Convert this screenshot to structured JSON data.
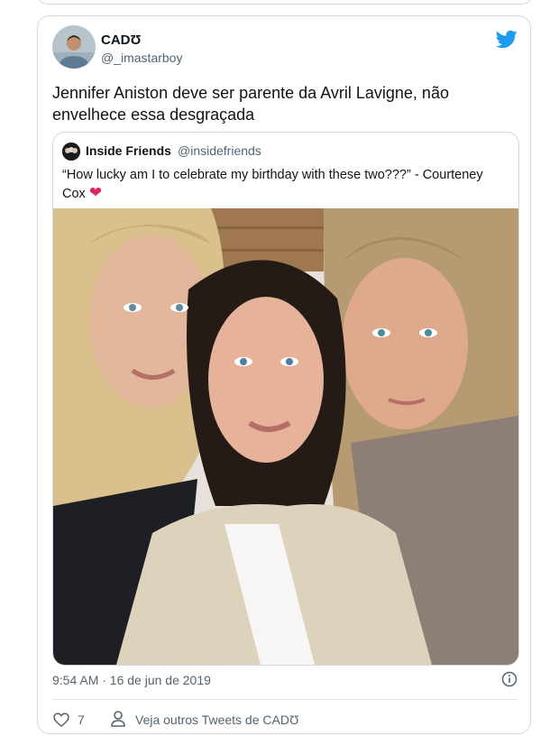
{
  "tweet": {
    "author_name": "CADƱ",
    "author_handle": "@_imastarboy",
    "text": "Jennifer Aniston deve ser parente da Avril Lavigne, não envelhece essa desgraçada",
    "timestamp": "9:54 AM · 16 de jun de 2019",
    "likes": "7",
    "more_tweets_label": "Veja outros Tweets de CADƱ"
  },
  "quoted": {
    "author_name": "Inside Friends",
    "author_handle": "@insidefriends",
    "text": "“How lucky am I to celebrate my birthday with these two???” - Courteney Cox",
    "emoji": "❤"
  },
  "colors": {
    "twitter_blue": "#1d9bf0",
    "secondary_text": "#536471",
    "border": "#cfd9de",
    "heart": "#e0245e"
  },
  "icons": [
    "twitter-bird-icon",
    "info-icon",
    "heart-outline-icon",
    "person-icon"
  ]
}
